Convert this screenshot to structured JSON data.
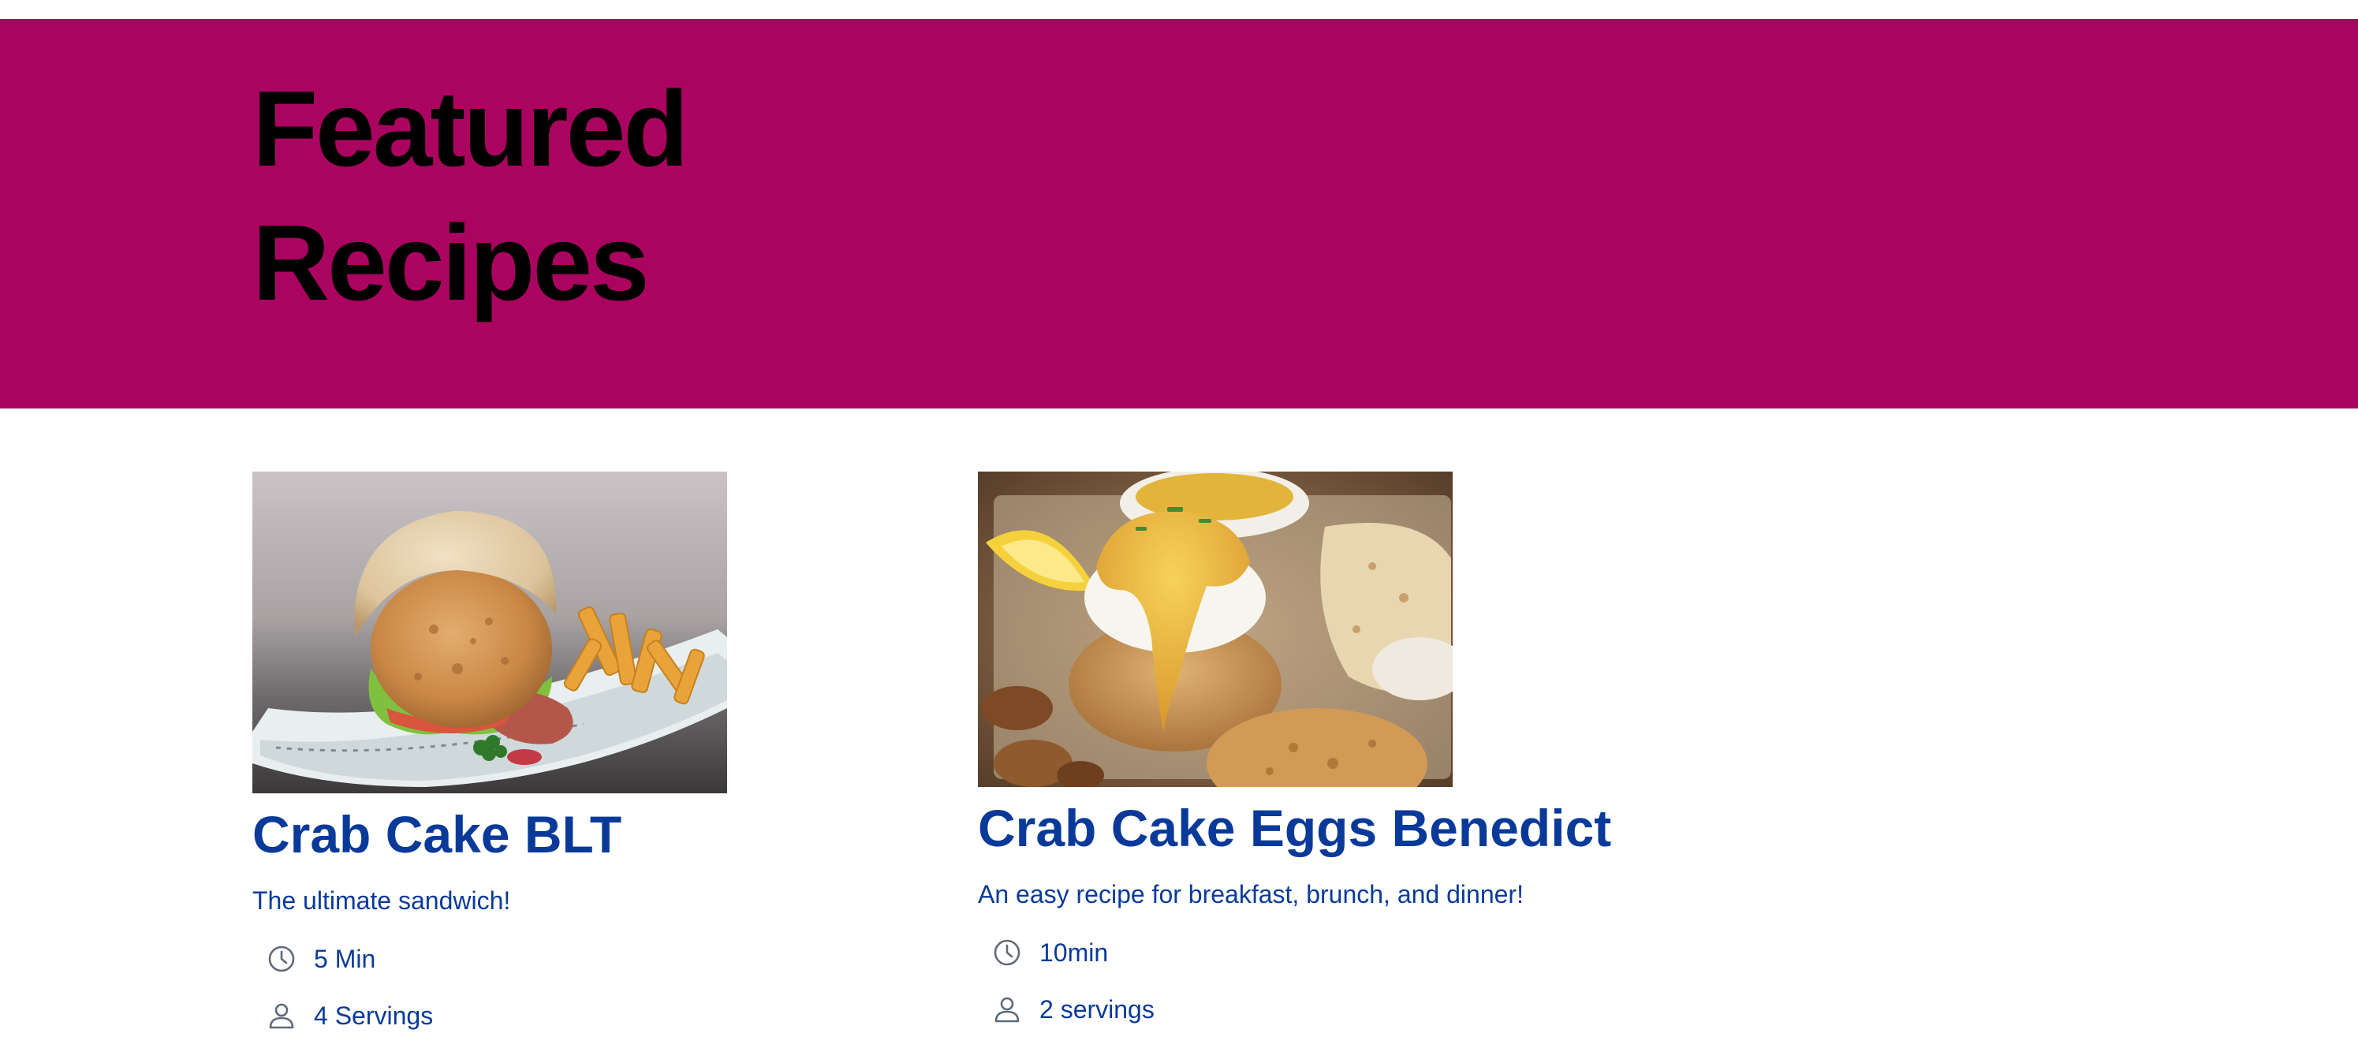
{
  "hero": {
    "title_line1": "Featured",
    "title_line2": "Recipes",
    "background_color": "#ab0460"
  },
  "recipes": [
    {
      "title": "Crab Cake BLT",
      "description": "The ultimate sandwich!",
      "time": "5 Min",
      "servings": "4 Servings",
      "image": "crab-cake-burger-photo"
    },
    {
      "title": "Crab Cake Eggs Benedict",
      "description": "An easy recipe for breakfast, brunch, and dinner!",
      "time": "10min",
      "servings": "2 servings",
      "image": "crab-cake-eggs-benedict-photo"
    }
  ],
  "icons": {
    "time": "clock-icon",
    "servings": "person-icon"
  },
  "colors": {
    "link_blue": "#0a3a99",
    "icon_gray": "#5f6b7a"
  }
}
